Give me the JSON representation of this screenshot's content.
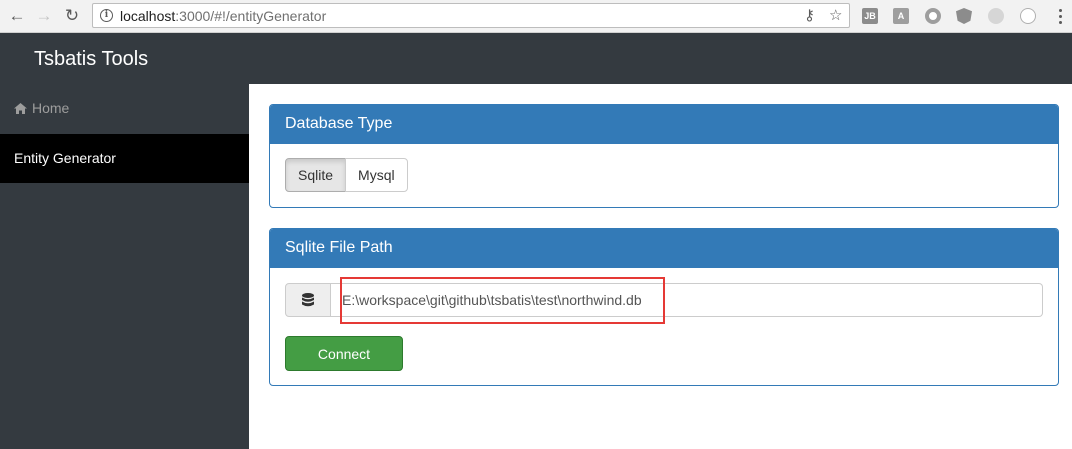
{
  "browser": {
    "url_host": "localhost",
    "url_path": ":3000/#!/entityGenerator",
    "extensions": [
      "JB",
      "A"
    ]
  },
  "app": {
    "brand": "Tsbatis Tools"
  },
  "sidebar": {
    "items": [
      {
        "label": "Home",
        "icon": "home-icon"
      },
      {
        "label": "Entity Generator"
      }
    ]
  },
  "database_type_panel": {
    "title": "Database Type",
    "options": [
      "Sqlite",
      "Mysql"
    ],
    "selected": "Sqlite"
  },
  "file_path_panel": {
    "title": "Sqlite File Path",
    "path_value": "E:\\workspace\\git\\github\\tsbatis\\test\\northwind.db",
    "connect_label": "Connect"
  },
  "colors": {
    "primary": "#337ab7",
    "success": "#449d44",
    "dark": "#343a40",
    "highlight": "#e53935"
  }
}
